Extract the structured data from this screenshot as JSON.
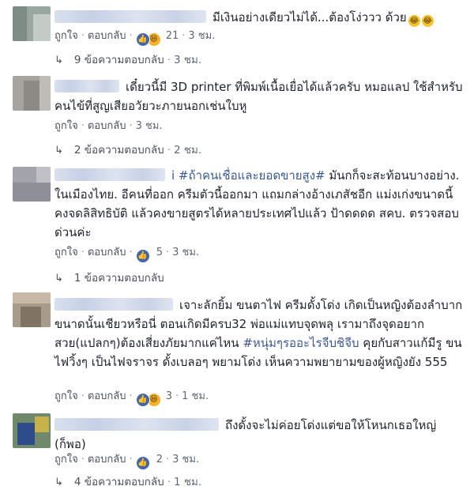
{
  "comments": [
    {
      "text": "มีเงินอย่างเดียวไม่ได้...ต้องโง่ววว ด้วย",
      "emoji": [
        "laughing-emoji",
        "laughing-emoji"
      ],
      "actions": {
        "like": "ถูกใจ",
        "reply": "ตอบกลับ",
        "reactions": [
          "like",
          "haha"
        ],
        "count": "21",
        "time": "3 ชม."
      },
      "replies": {
        "label": "9 ข้อความตอบกลับ",
        "time": "3 ชม."
      }
    },
    {
      "text": "เดี๋ยวนี้มี 3D printer ที่พิมพ์เนื้อเยื่อได้แล้วครับ หมอแลป ใช้สำหรับคนไข้ที่สูญเสียอวัยวะภายนอกเช่นใบหู",
      "actions": {
        "like": "ถูกใจ",
        "reply": "ตอบกลับ",
        "time": "3 ชม."
      },
      "replies": {
        "label": "2 ข้อความตอบกลับ",
        "time": "2 ชม."
      }
    },
    {
      "tag": "i #ถ้าคนเชื่อและยอดขายสูง#",
      "text": "มันกก็จะสะท้อนบางอย่าง. ในเมืองไทย. อีคนที่ออก ครีมตัวนี้ออกมา แถมกล่างอ้างเภสัชอีก แม่งเก่งขนาดนี้ คงจดลิสิทธิบัติ แล้วคงขายสูตรได้หลายประเทศไปแล้ว ป้าดดดด สคบ. ตรวจสอบด่วนค่ะ",
      "actions": {
        "like": "ถูกใจ",
        "reply": "ตอบกลับ",
        "reactions": [
          "like"
        ],
        "count": "5",
        "time": "3 ชม."
      },
      "replies": {
        "label": "1 ข้อความตอบกลับ"
      }
    },
    {
      "text_a": "เจาะลักยิ้ม ขนตาไฟ ครีมดั้งโด่ง เกิดเป็นหญิงต้องลำบากขนาดนั้นเชียวหรือนี่ ตอนเกิดมีครบ32 พ่อแม่แทบจุดพลุ เรามาถึงจุดอยากสวย(แปลกๆ)ต้องเสี่ยงภัยมากแค่ไหน",
      "tag": "#หนุ่มๆรออะไรจีบชิจีบ",
      "text_b": "คุยกับสาวแก้มีรู ขนไฟวิ้งๆ เป็นไฟจราจร ดั้งเบลอๆ พยามโด่ง เห็นความพยายามของผู้หญิงยัง 555",
      "actions": {
        "like": "ถูกใจ",
        "reply": "ตอบกลับ",
        "reactions": [
          "like",
          "haha"
        ],
        "count": "3",
        "time": "1 ชม."
      }
    },
    {
      "text": "ถึงดั้งจะไม่ค่อยโด่งแต่ขอให้โหนกเธอใหญ่ (ก็พอ)",
      "actions": {
        "like": "ถูกใจ",
        "reply": "ตอบกลับ",
        "reactions": [
          "like"
        ],
        "count": "2",
        "time": "3 ชม."
      },
      "replies": {
        "label": "4 ข้อความตอบกลับ",
        "time": "1 ชม."
      }
    }
  ],
  "reply_arrow_icon": "reply-arrow-icon"
}
